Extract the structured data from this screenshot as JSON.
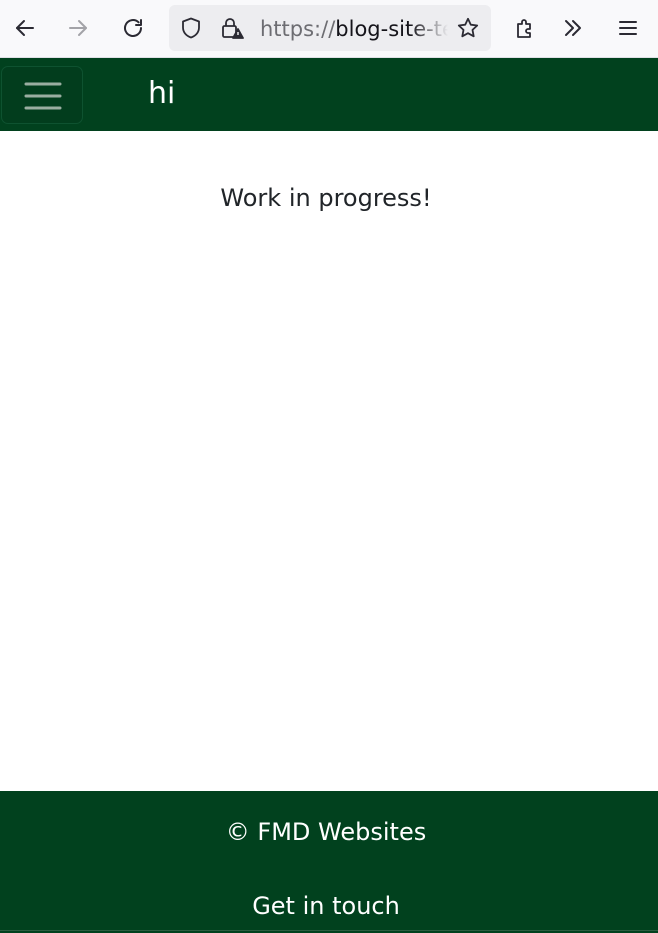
{
  "browser": {
    "url_scheme": "https://",
    "url_host": "blog-site-template",
    "icons": {
      "back": "arrow-left-icon",
      "forward": "arrow-right-icon",
      "reload": "reload-icon",
      "tracking": "shield-icon",
      "security": "lock-warning-icon",
      "bookmark": "star-icon",
      "extensions": "puzzle-icon",
      "overflow": "double-chevron-icon",
      "menu": "hamburger-menu-icon"
    }
  },
  "navbar": {
    "brand": "hi",
    "background": "#01411e",
    "toggle_icon": "hamburger-menu-icon"
  },
  "main": {
    "message": "Work in progress!"
  },
  "footer": {
    "copyright": "© FMD Websites",
    "contact_link": "Get in touch",
    "background": "#01411e"
  }
}
